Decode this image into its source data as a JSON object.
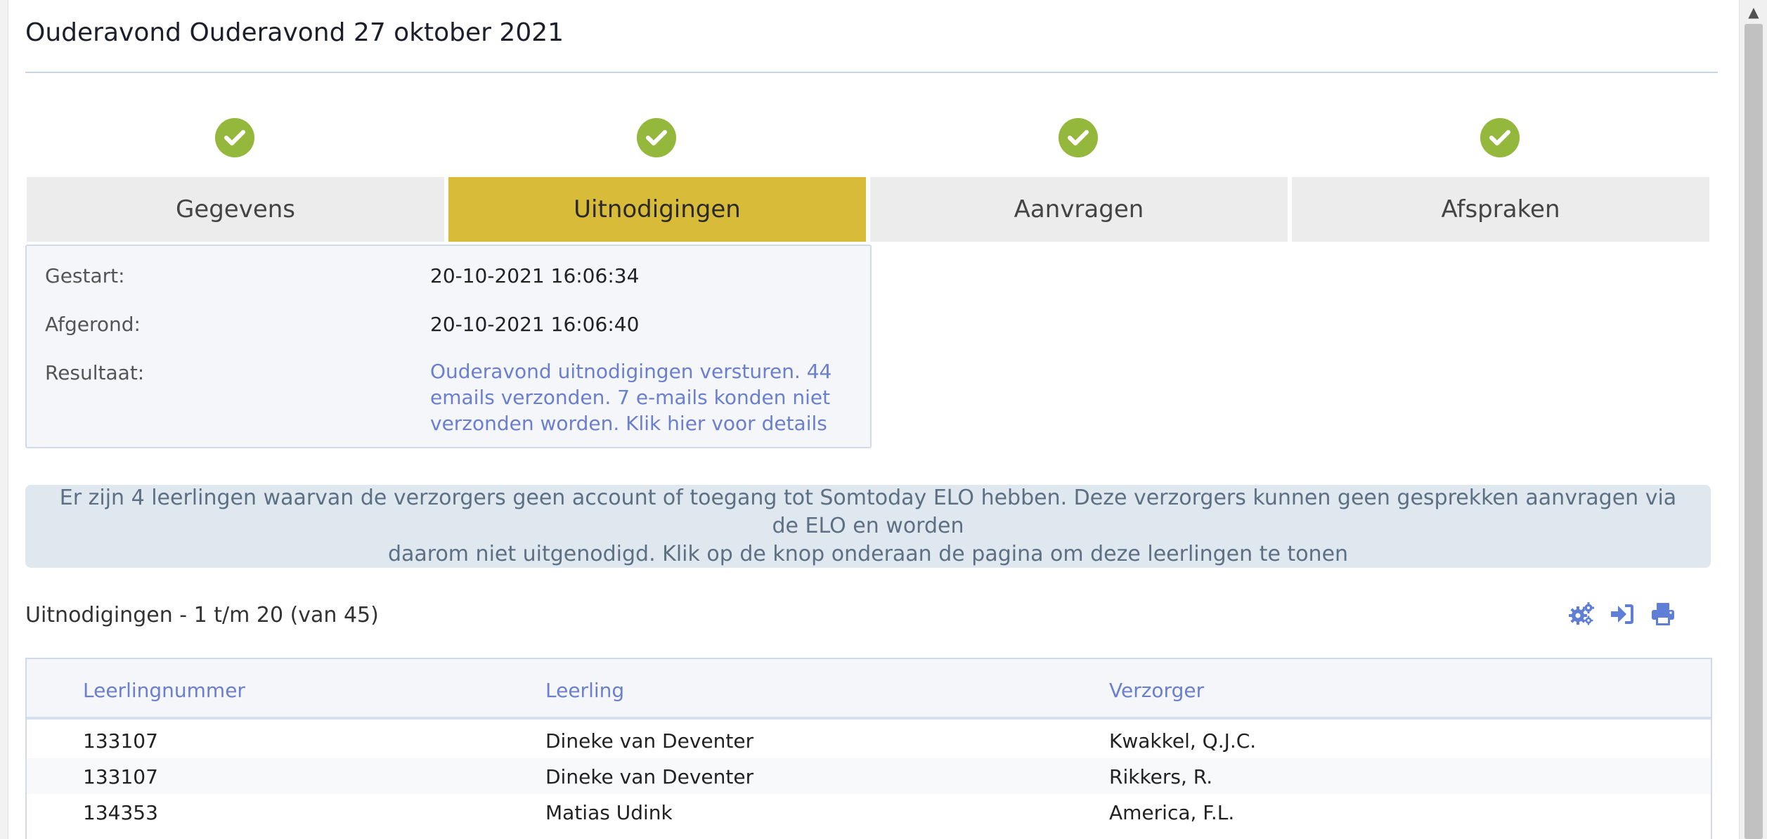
{
  "title": "Ouderavond Ouderavond 27 oktober 2021",
  "steps": [
    {
      "label": "Gegevens",
      "done": true,
      "active": false
    },
    {
      "label": "Uitnodigingen",
      "done": true,
      "active": true
    },
    {
      "label": "Aanvragen",
      "done": true,
      "active": false
    },
    {
      "label": "Afspraken",
      "done": true,
      "active": false
    }
  ],
  "info": {
    "started_label": "Gestart:",
    "started_value": "20-10-2021 16:06:34",
    "finished_label": "Afgerond:",
    "finished_value": "20-10-2021 16:06:40",
    "result_label": "Resultaat:",
    "result_line1": "Ouderavond uitnodigingen versturen. 44",
    "result_line2": "emails verzonden. 7 e-mails konden niet",
    "result_line3": "verzonden worden. Klik hier voor details"
  },
  "notice": {
    "line1": "Er zijn 4 leerlingen waarvan de verzorgers geen account of toegang tot Somtoday ELO hebben. Deze verzorgers kunnen geen gesprekken aanvragen via de ELO en worden",
    "line2": "daarom niet uitgenodigd. Klik op de knop onderaan de pagina om deze leerlingen te tonen"
  },
  "section_title": "Uitnodigingen - 1 t/m 20 (van 45)",
  "toolbar": {
    "icons": [
      "cogs-icon",
      "sign-in-icon",
      "print-icon"
    ]
  },
  "table": {
    "columns": [
      "Leerlingnummer",
      "Leerling",
      "Verzorger"
    ],
    "rows": [
      [
        "133107",
        "Dineke van Deventer",
        "Kwakkel, Q.J.C."
      ],
      [
        "133107",
        "Dineke van Deventer",
        "Rikkers, R."
      ],
      [
        "134353",
        "Matias Udink",
        "America, F.L."
      ]
    ]
  },
  "colors": {
    "accent": "#d9bb3a",
    "check": "#93b83b",
    "link": "#6a7fd0",
    "notice_bg": "#dfe7ef"
  }
}
